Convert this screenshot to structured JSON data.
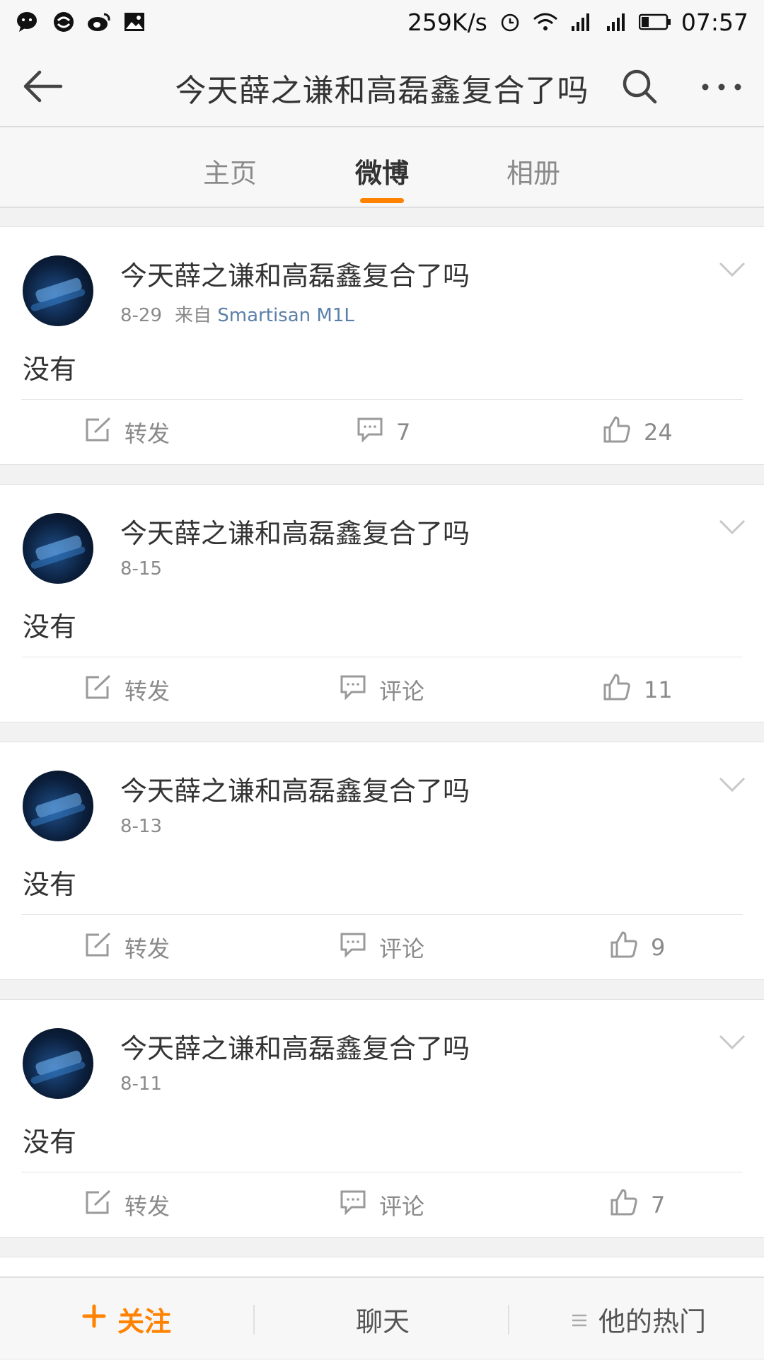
{
  "status_bar": {
    "network_speed": "259K/s",
    "time": "07:57",
    "left_icons": [
      "wechat-icon",
      "qq-icon",
      "weibo-icon",
      "gallery-icon"
    ],
    "right_icons": [
      "alarm-icon",
      "wifi-icon",
      "signal-icon",
      "signal-icon",
      "battery-icon"
    ]
  },
  "header": {
    "title": "今天薛之谦和高磊鑫复合了吗",
    "back_icon": "back-arrow-icon",
    "search_icon": "search-icon",
    "more_icon": "more-icon"
  },
  "tabs": [
    {
      "label": "主页",
      "active": false
    },
    {
      "label": "微博",
      "active": true
    },
    {
      "label": "相册",
      "active": false
    }
  ],
  "accent_color": "#ff8200",
  "posts": [
    {
      "username": "今天薛之谦和高磊鑫复合了吗",
      "date": "8-29",
      "from_label": "来自",
      "device": "Smartisan M1L",
      "content": "没有",
      "repost_label": "转发",
      "comment_label": "7",
      "like_count": "24"
    },
    {
      "username": "今天薛之谦和高磊鑫复合了吗",
      "date": "8-15",
      "from_label": "",
      "device": "",
      "content": "没有",
      "repost_label": "转发",
      "comment_label": "评论",
      "like_count": "11"
    },
    {
      "username": "今天薛之谦和高磊鑫复合了吗",
      "date": "8-13",
      "from_label": "",
      "device": "",
      "content": "没有",
      "repost_label": "转发",
      "comment_label": "评论",
      "like_count": "9"
    },
    {
      "username": "今天薛之谦和高磊鑫复合了吗",
      "date": "8-11",
      "from_label": "",
      "device": "",
      "content": "没有",
      "repost_label": "转发",
      "comment_label": "评论",
      "like_count": "7"
    }
  ],
  "bottom_bar": {
    "follow_label": "关注",
    "chat_label": "聊天",
    "hot_label": "他的热门"
  }
}
